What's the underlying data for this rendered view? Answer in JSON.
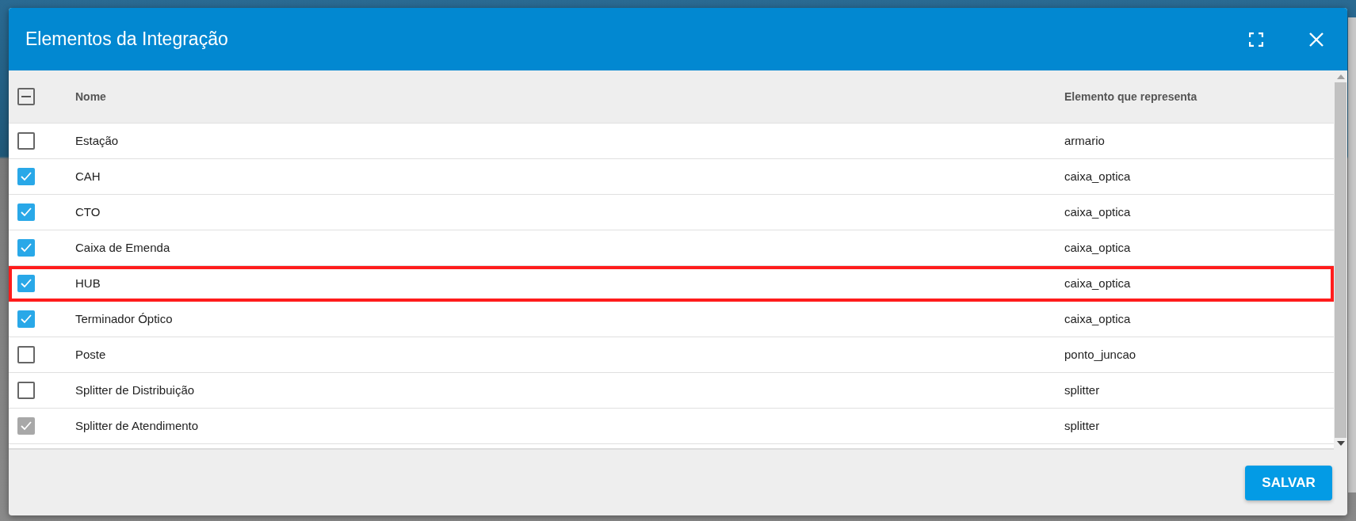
{
  "dialog": {
    "title": "Elementos da Integração",
    "table": {
      "header_checkbox": {
        "indeterminate": true
      },
      "columns": [
        "Nome",
        "Elemento que representa"
      ],
      "rows": [
        {
          "name": "Estação",
          "element": "armario",
          "checked": false,
          "disabled": false,
          "highlighted": false
        },
        {
          "name": "CAH",
          "element": "caixa_optica",
          "checked": true,
          "disabled": false,
          "highlighted": false
        },
        {
          "name": "CTO",
          "element": "caixa_optica",
          "checked": true,
          "disabled": false,
          "highlighted": false
        },
        {
          "name": "Caixa de Emenda",
          "element": "caixa_optica",
          "checked": true,
          "disabled": false,
          "highlighted": false
        },
        {
          "name": "HUB",
          "element": "caixa_optica",
          "checked": true,
          "disabled": false,
          "highlighted": true
        },
        {
          "name": "Terminador Óptico",
          "element": "caixa_optica",
          "checked": true,
          "disabled": false,
          "highlighted": false
        },
        {
          "name": "Poste",
          "element": "ponto_juncao",
          "checked": false,
          "disabled": false,
          "highlighted": false
        },
        {
          "name": "Splitter de Distribuição",
          "element": "splitter",
          "checked": false,
          "disabled": false,
          "highlighted": false
        },
        {
          "name": "Splitter de Atendimento",
          "element": "splitter",
          "checked": true,
          "disabled": true,
          "highlighted": false
        }
      ]
    },
    "buttons": [
      "SALVAR"
    ]
  }
}
